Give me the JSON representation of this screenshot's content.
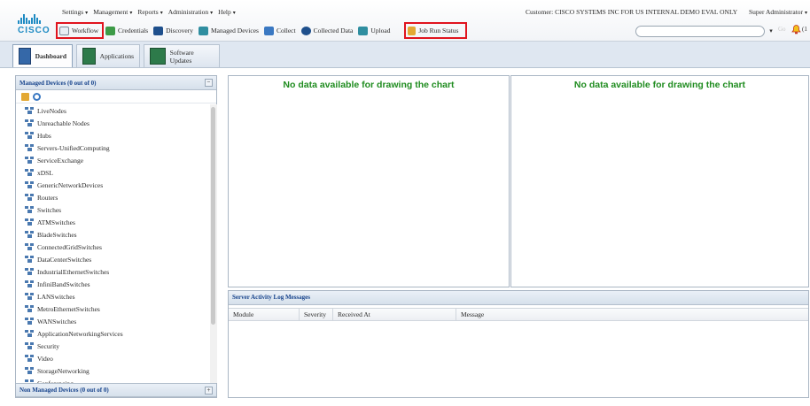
{
  "header": {
    "logo_text": "CISCO",
    "menu": [
      {
        "label": "Settings",
        "caret": "▾"
      },
      {
        "label": "Management",
        "caret": "▾"
      },
      {
        "label": "Reports",
        "caret": "▾"
      },
      {
        "label": "Administration",
        "caret": "▾"
      },
      {
        "label": "Help",
        "caret": "▾"
      }
    ],
    "customer": "Customer: CISCO SYSTEMS INC FOR US INTERNAL DEMO EVAL ONLY",
    "user": "Super Administrator",
    "user_caret": "▾",
    "search_placeholder": "",
    "search_dropdown": "▾",
    "go_label": "Go",
    "alert_count": "(1"
  },
  "toolbar": [
    {
      "label": "Workflow",
      "icon": "workflow-icon"
    },
    {
      "label": "Credentials",
      "icon": "credentials-icon"
    },
    {
      "label": "Discovery",
      "icon": "discovery-icon"
    },
    {
      "label": "Managed Devices",
      "icon": "managed-devices-icon"
    },
    {
      "label": "Collect",
      "icon": "collect-icon"
    },
    {
      "label": "Collected Data",
      "icon": "collected-data-icon"
    },
    {
      "label": "Upload",
      "icon": "upload-icon"
    },
    {
      "label": "Job Run Status",
      "icon": "job-run-status-icon"
    }
  ],
  "tabs": [
    {
      "label": "Dashboard"
    },
    {
      "label": "Applications"
    },
    {
      "label": "Software Updates"
    }
  ],
  "left_panel": {
    "managed_title": "Managed Devices (0 out of 0)",
    "managed_btn": "−",
    "non_managed_title": "Non Managed Devices (0 out of 0)",
    "non_managed_btn": "+",
    "groups": [
      "LiveNodes",
      "Unreachable Nodes",
      "Hubs",
      "Servers-UnifiedComputing",
      "ServiceExchange",
      "xDSL",
      "GenericNetworkDevices",
      "Routers",
      "Switches",
      "ATMSwitches",
      "BladeSwitches",
      "ConnectedGridSwitches",
      "DataCenterSwitches",
      "IndustrialEthernetSwitches",
      "InfiniBandSwitches",
      "LANSwitches",
      "MetroEthernetSwitches",
      "WANSwitches",
      "ApplicationNetworkingServices",
      "Security",
      "Video",
      "StorageNetworking",
      "Conferencing"
    ]
  },
  "charts": {
    "left_message": "No data available for drawing the chart",
    "right_message": "No data available for drawing the chart"
  },
  "log_panel": {
    "title": "Server Activity Log Messages",
    "columns": [
      "Module",
      "Severity",
      "Received At",
      "Message"
    ]
  },
  "colors": {
    "no_data_text": "#1f8c1f",
    "highlight_outline": "#e0141e",
    "panel_header_text": "#15428b"
  }
}
